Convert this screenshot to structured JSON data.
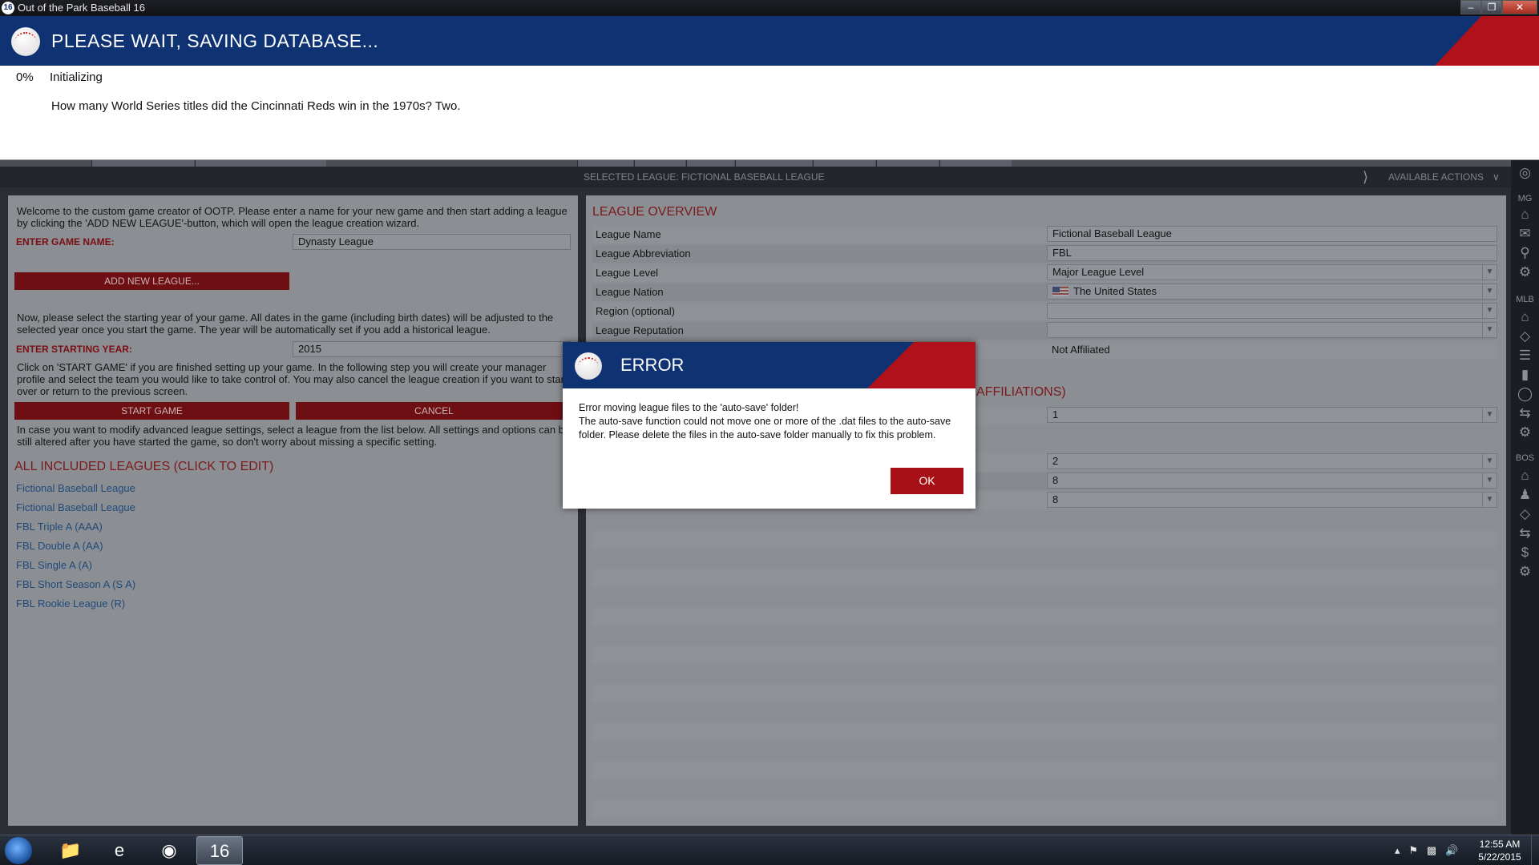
{
  "window": {
    "title": "Out of the Park Baseball 16",
    "app_icon": "16"
  },
  "saving": {
    "title": "PLEASE WAIT, SAVING DATABASE...",
    "percent": "0%",
    "status": "Initializing",
    "tip": "How many World Series titles did the Cincinnati Reds win in the 1970s? Two."
  },
  "league_bar": {
    "selected": "SELECTED LEAGUE: FICTIONAL BASEBALL LEAGUE",
    "actions": "AVAILABLE ACTIONS"
  },
  "rail": {
    "mg": "MG",
    "mlb": "MLB",
    "bos": "BOS"
  },
  "left": {
    "intro": "Welcome to the custom game creator of OOTP. Please enter a name for your new game and then start adding a league by clicking the 'ADD NEW LEAGUE'-button, which will open the league creation wizard.",
    "game_name_label": "ENTER GAME NAME:",
    "game_name_value": "Dynasty League",
    "add_league_button": "ADD NEW LEAGUE...",
    "year_intro": "Now, please select the starting year of your game. All dates in the game (including birth dates) will be adjusted to the selected year once you start the game. The year will be automatically set if you add a historical league.",
    "year_label": "ENTER STARTING YEAR:",
    "year_value": "2015",
    "start_intro": "Click on 'START GAME' if you are finished setting up your game. In the following step you will create your manager profile and select the team you would like to take control of. You may also cancel the league creation if you want to start over or return to the previous screen.",
    "start_button": "START GAME",
    "cancel_button": "CANCEL",
    "advanced_intro": "In case you want to modify advanced league settings, select a league from the list below. All settings and options can be still altered after you have started the game, so don't worry about missing a specific setting.",
    "leagues_header": "ALL INCLUDED LEAGUES (CLICK TO EDIT)",
    "leagues": [
      "Fictional Baseball League",
      "Fictional Baseball League",
      "FBL Triple A (AAA)",
      "FBL Double A (AA)",
      "FBL Single A (A)",
      "FBL Short Season A (S A)",
      "FBL Rookie League (R)"
    ]
  },
  "overview": {
    "header": "LEAGUE OVERVIEW",
    "rows": [
      {
        "key": "League Name",
        "value": "Fictional Baseball League"
      },
      {
        "key": "League Abbreviation",
        "value": "FBL"
      },
      {
        "key": "League Level",
        "value": "Major League Level"
      },
      {
        "key": "League Nation",
        "value": "The United States"
      },
      {
        "key": "Region (optional)",
        "value": ""
      },
      {
        "key": "League Reputation",
        "value": ""
      }
    ],
    "affiliation_value": "Not Affiliated",
    "affiliations_header_fragment": "AFFILIATIONS)",
    "structure_values": [
      "1",
      "2",
      "8",
      "8"
    ]
  },
  "error_dialog": {
    "title": "ERROR",
    "line1": "Error moving league files to the 'auto-save' folder!",
    "line2": "The auto-save function could not move one or more of the .dat files to the auto-save folder. Please delete the files in the auto-save folder manually to fix this problem.",
    "ok_label": "OK"
  },
  "taskbar": {
    "apps": [
      "windows-explorer",
      "internet-explorer",
      "chrome",
      "ootp16"
    ],
    "ootp_label": "16",
    "time": "12:55 AM",
    "date": "5/22/2015"
  },
  "colors": {
    "brand_blue": "#0e3272",
    "brand_red": "#b1111a",
    "button_red": "#a70f16"
  }
}
